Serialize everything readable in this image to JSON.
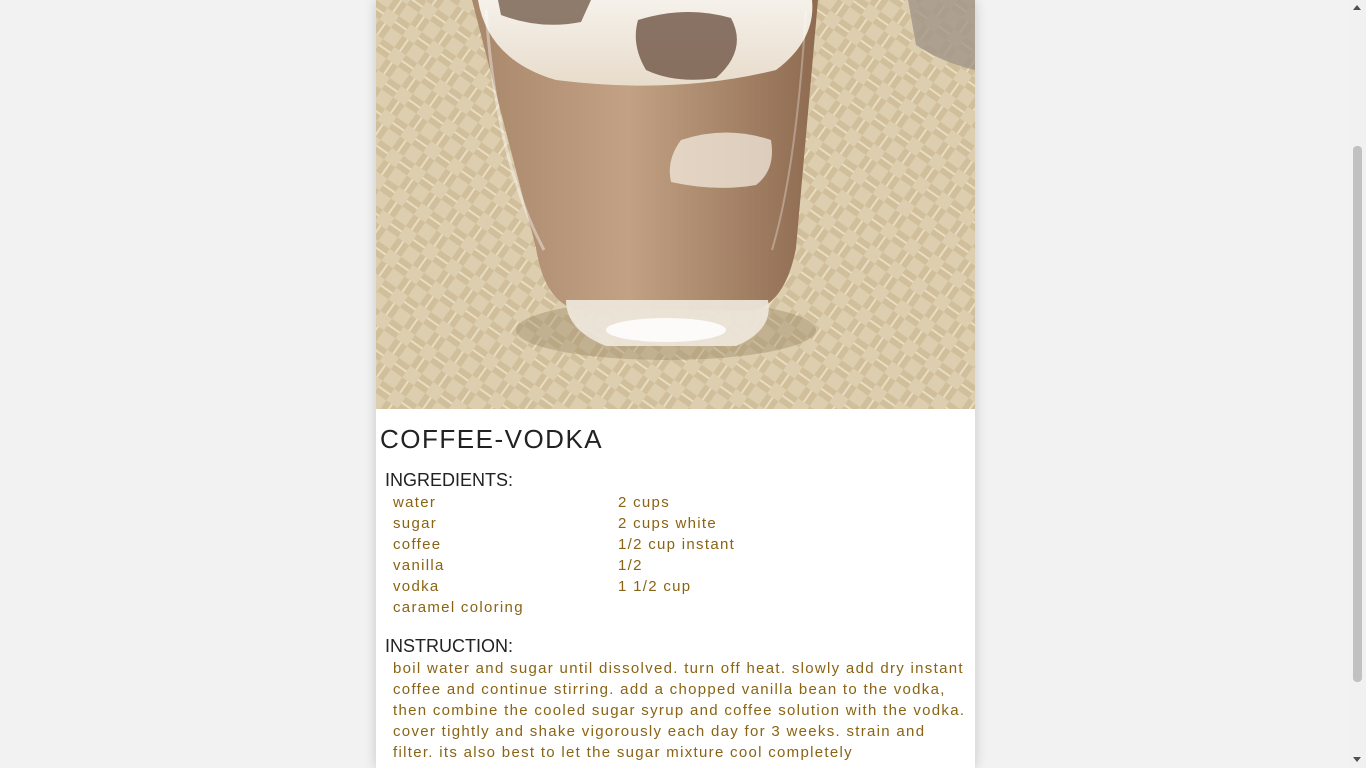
{
  "recipe": {
    "title": "COFFEE-VODKA",
    "ingredients_heading": "INGREDIENTS:",
    "ingredients": [
      {
        "name": "water",
        "amount": "2 cups"
      },
      {
        "name": "sugar",
        "amount": "2 cups white"
      },
      {
        "name": "coffee",
        "amount": "1/2 cup instant"
      },
      {
        "name": "vanilla",
        "amount": "1/2"
      },
      {
        "name": "vodka",
        "amount": "1 1/2 cup"
      },
      {
        "name": "caramel coloring",
        "amount": ""
      }
    ],
    "instructions_heading": "INSTRUCTION:",
    "instructions": "boil water and sugar until dissolved. turn off heat. slowly add dry instant coffee and continue stirring. add a chopped vanilla bean to the vodka, then combine the cooled sugar syrup and coffee solution with the vodka. cover tightly and shake vigorously each day for 3 weeks. strain and filter. its also best to let the sugar mixture cool completely"
  },
  "colors": {
    "page_background": "#f2f2f2",
    "card_background": "#ffffff",
    "heading_text": "#222222",
    "body_text": "#8a6414"
  }
}
